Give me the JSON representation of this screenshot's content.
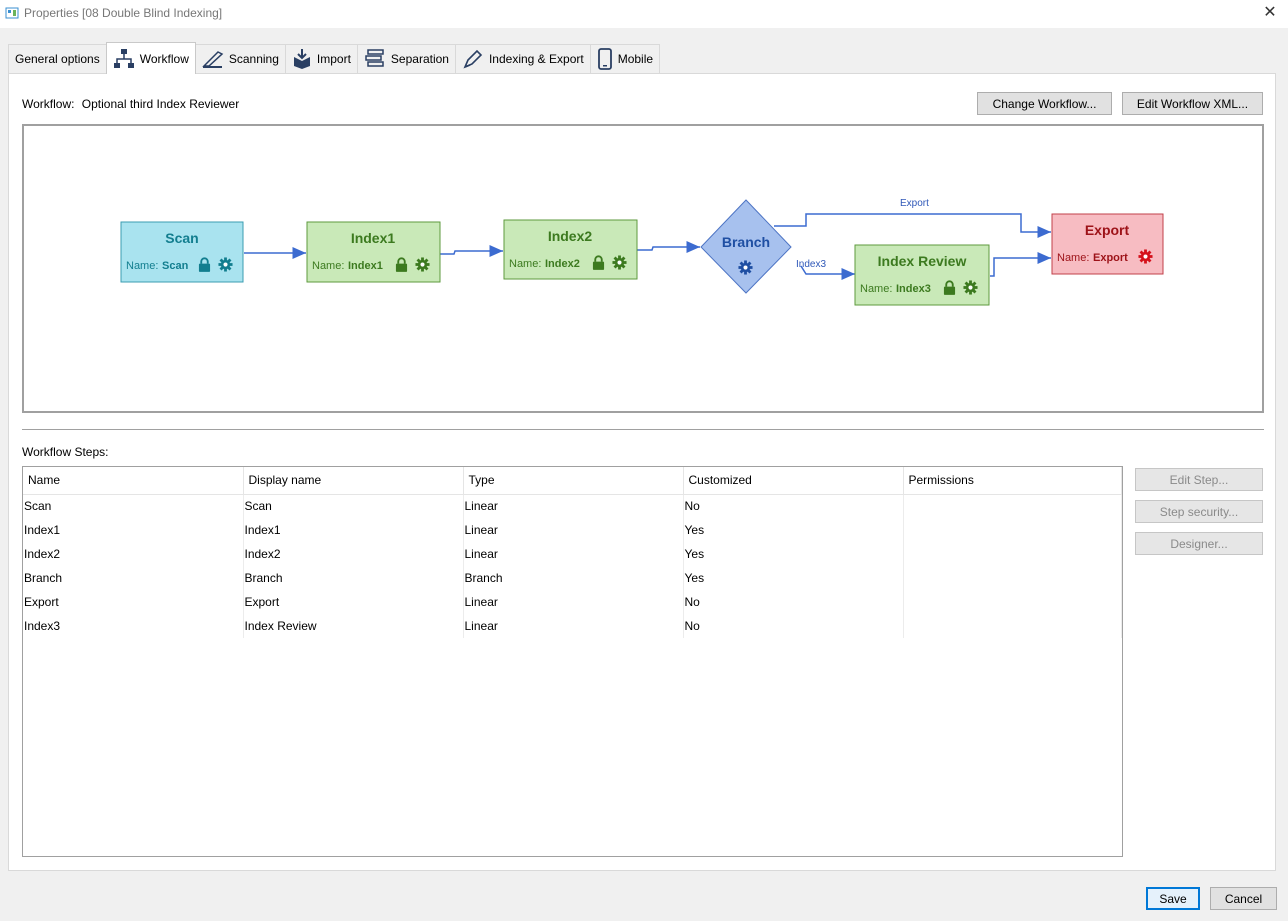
{
  "window": {
    "title": "Properties [08 Double Blind Indexing]",
    "close_glyph": "✕"
  },
  "tabs": [
    {
      "label": "General options",
      "icon": "none"
    },
    {
      "label": "Workflow",
      "icon": "workflow-icon"
    },
    {
      "label": "Scanning",
      "icon": "scanner-icon"
    },
    {
      "label": "Import",
      "icon": "import-box-icon"
    },
    {
      "label": "Separation",
      "icon": "separation-stack-icon"
    },
    {
      "label": "Indexing & Export",
      "icon": "pen-icon"
    },
    {
      "label": "Mobile",
      "icon": "phone-icon"
    }
  ],
  "workflow": {
    "label": "Workflow:",
    "name": "Optional third Index Reviewer",
    "change_button": "Change Workflow...",
    "edit_xml_button": "Edit Workflow XML..."
  },
  "diagram": {
    "name_prefix": "Name:",
    "nodes": {
      "scan": {
        "title": "Scan",
        "name": "Scan",
        "color": "#a9e3ef",
        "accent": "#127e8f"
      },
      "index1": {
        "title": "Index1",
        "name": "Index1",
        "color": "#c9e9b8",
        "accent": "#3c7a1f"
      },
      "index2": {
        "title": "Index2",
        "name": "Index2",
        "color": "#c9e9b8",
        "accent": "#3c7a1f"
      },
      "branch": {
        "title": "Branch",
        "color": "#a7c1ee",
        "accent": "#1f4fa3"
      },
      "index_review": {
        "title": "Index Review",
        "name": "Index3",
        "color": "#c9e9b8",
        "accent": "#3c7a1f"
      },
      "export": {
        "title": "Export",
        "name": "Export",
        "color": "#f7bcc2",
        "accent": "#9d1218"
      }
    },
    "edge_labels": {
      "export": "Export",
      "index3": "Index3"
    },
    "edge_color": "#3c6bd0"
  },
  "steps": {
    "label": "Workflow Steps:",
    "columns": [
      "Name",
      "Display name",
      "Type",
      "Customized",
      "Permissions"
    ],
    "rows": [
      [
        "Scan",
        "Scan",
        "Linear",
        "No",
        ""
      ],
      [
        "Index1",
        "Index1",
        "Linear",
        "Yes",
        ""
      ],
      [
        "Index2",
        "Index2",
        "Linear",
        "Yes",
        ""
      ],
      [
        "Branch",
        "Branch",
        "Branch",
        "Yes",
        ""
      ],
      [
        "Export",
        "Export",
        "Linear",
        "No",
        ""
      ],
      [
        "Index3",
        "Index Review",
        "Linear",
        "No",
        ""
      ]
    ],
    "buttons": {
      "edit_step": "Edit Step...",
      "step_security": "Step security...",
      "designer": "Designer..."
    }
  },
  "footer": {
    "save": "Save",
    "cancel": "Cancel"
  }
}
